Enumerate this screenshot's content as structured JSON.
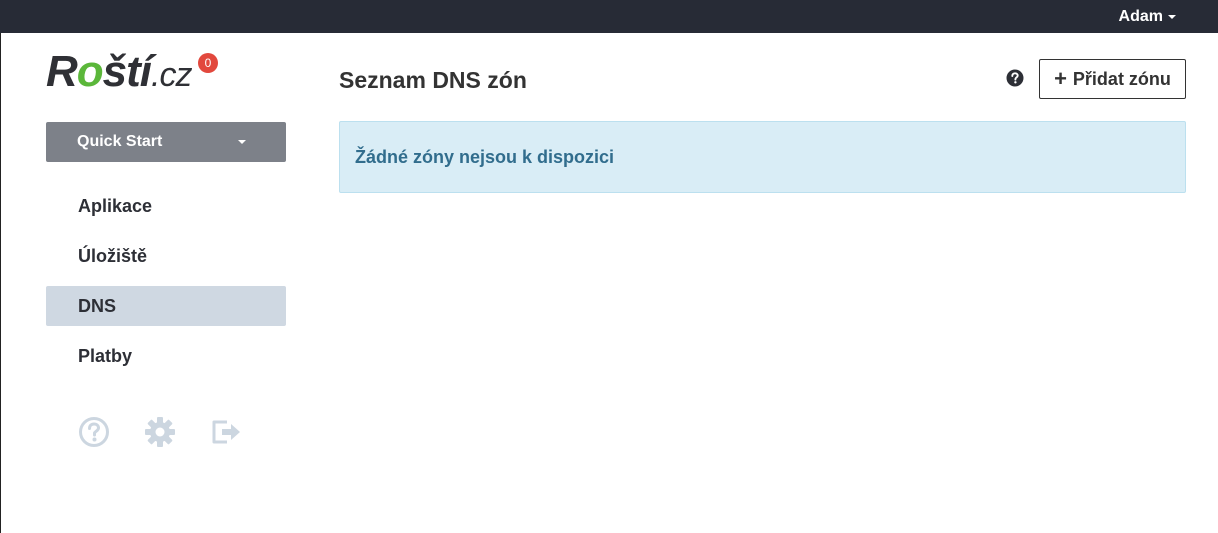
{
  "topbar": {
    "user_name": "Adam"
  },
  "logo": {
    "prefix": "R",
    "leaf_letter": "o",
    "rest": "ští",
    "tld": ".cz",
    "notifications_count": "0"
  },
  "sidebar": {
    "quick_start_label": "Quick Start",
    "items": [
      {
        "label": "Aplikace",
        "active": false
      },
      {
        "label": "Úložiště",
        "active": false
      },
      {
        "label": "DNS",
        "active": true
      },
      {
        "label": "Platby",
        "active": false
      }
    ],
    "bottom_icons": [
      "help-circle-icon",
      "gear-icon",
      "logout-icon"
    ]
  },
  "main": {
    "title": "Seznam DNS zón",
    "add_button_label": "Přidat zónu",
    "empty_message": "Žádné zóny nejsou k dispozici"
  },
  "colors": {
    "topbar": "#272b36",
    "brand_green": "#5bb73a",
    "badge_red": "#e2483d",
    "quick_start_bg": "#7d8189",
    "active_nav_bg": "#cfd8e2",
    "alert_bg": "#d9edf6",
    "alert_text": "#316d8d"
  }
}
